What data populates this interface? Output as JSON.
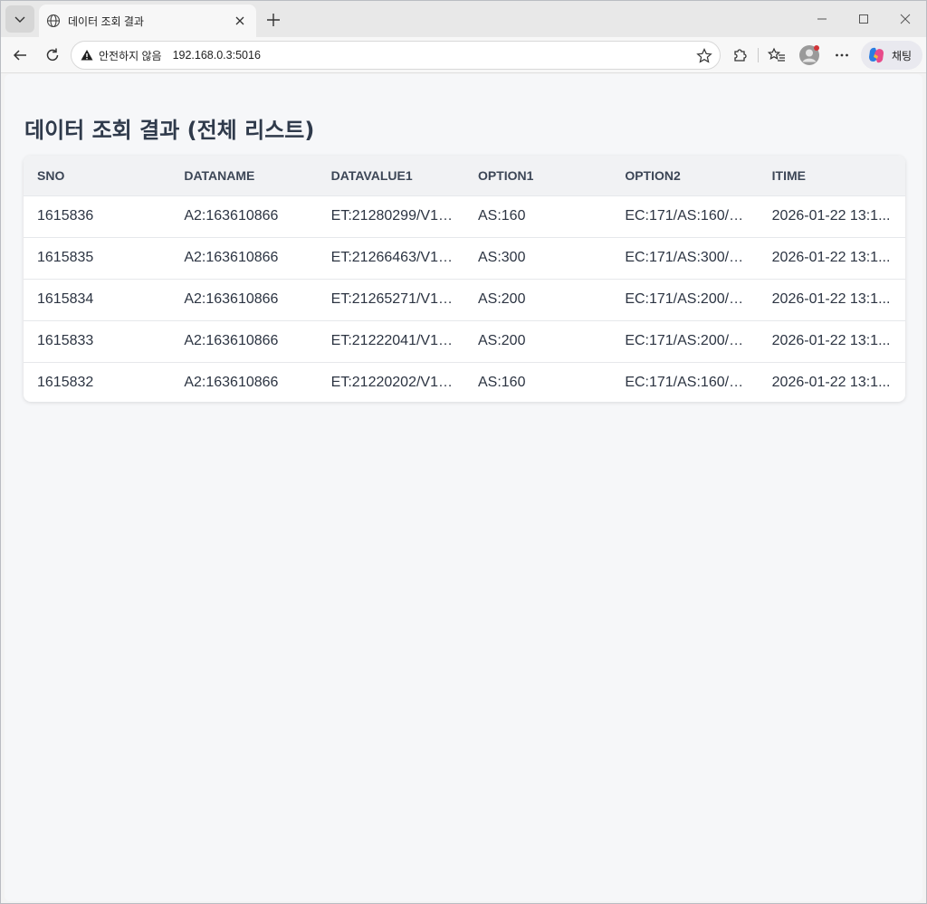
{
  "browser": {
    "tab_title": "데이터 조회 결과",
    "security_label": "안전하지 않음",
    "url": "192.168.0.3:5016",
    "copilot_label": "채팅"
  },
  "page": {
    "title": "데이터 조회 결과 (전체 리스트)"
  },
  "table": {
    "columns": [
      "SNO",
      "DATANAME",
      "DATAVALUE1",
      "OPTION1",
      "OPTION2",
      "ITIME"
    ],
    "rows": [
      [
        "1615836",
        "A2:163610866",
        "ET:21280299/V1:...",
        "AS:160",
        "EC:171/AS:160/B...",
        "2026-01-22 13:1..."
      ],
      [
        "1615835",
        "A2:163610866",
        "ET:21266463/V1:...",
        "AS:300",
        "EC:171/AS:300/B...",
        "2026-01-22 13:1..."
      ],
      [
        "1615834",
        "A2:163610866",
        "ET:21265271/V1:...",
        "AS:200",
        "EC:171/AS:200/B...",
        "2026-01-22 13:1..."
      ],
      [
        "1615833",
        "A2:163610866",
        "ET:21222041/V1:...",
        "AS:200",
        "EC:171/AS:200/B...",
        "2026-01-22 13:1..."
      ],
      [
        "1615832",
        "A2:163610866",
        "ET:21220202/V1:...",
        "AS:160",
        "EC:171/AS:160/B...",
        "2026-01-22 13:1..."
      ]
    ]
  },
  "icons": {
    "tab_menu": "chevron-down-icon",
    "tab_favicon": "globe-icon",
    "tab_close": "close-icon",
    "new_tab": "plus-icon",
    "back": "back-arrow-icon",
    "refresh": "refresh-icon",
    "warning": "warning-icon",
    "favorite": "star-icon",
    "extensions": "puzzle-icon",
    "favorites_list": "favorites-icon",
    "profile": "profile-icon",
    "more": "more-icon",
    "copilot": "copilot-icon"
  },
  "colors": {
    "title": "#2f3a4b",
    "header_bg": "#f1f2f4",
    "page_bg": "#f6f7f9",
    "profile_dot": "#d13438"
  }
}
